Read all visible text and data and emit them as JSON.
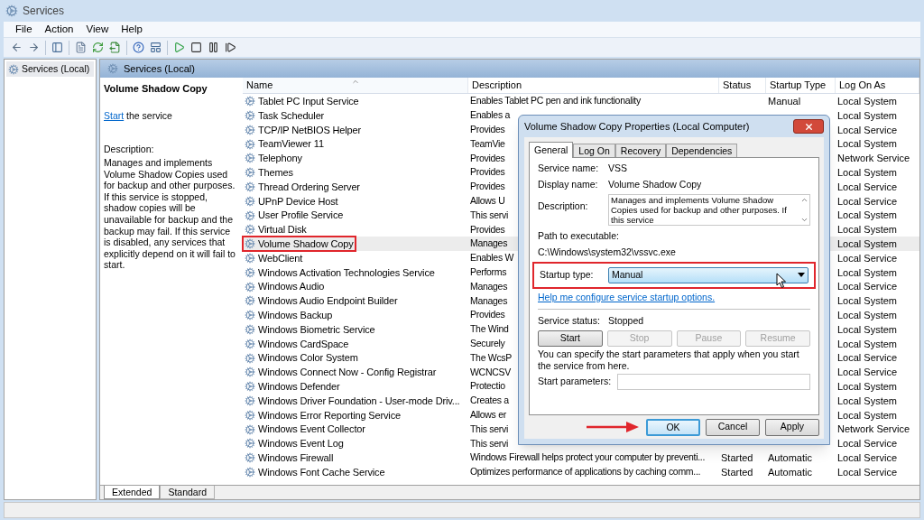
{
  "window": {
    "title": "Services"
  },
  "menu": [
    "File",
    "Action",
    "View",
    "Help"
  ],
  "tree": {
    "items": [
      {
        "label": "Services (Local)",
        "selected": true
      }
    ]
  },
  "panel": {
    "title": "Services (Local)"
  },
  "details": {
    "service_name": "Volume Shadow Copy",
    "start_link": "Start",
    "start_text": "the service",
    "description_label": "Description:",
    "description": "Manages and implements Volume Shadow Copies used for backup and other purposes. If this service is stopped, shadow copies will be unavailable for backup and the backup may fail. If this service is disabled, any services that explicitly depend on it will fail to start."
  },
  "table": {
    "columns": [
      {
        "label": "Name",
        "sorted": true
      },
      {
        "label": "Description",
        "sorted": false
      },
      {
        "label": "Status",
        "sorted": false
      },
      {
        "label": "Startup Type",
        "sorted": false
      },
      {
        "label": "Log On As",
        "sorted": false
      }
    ],
    "rows": [
      {
        "name": "Tablet PC Input Service",
        "description": "Enables Tablet PC pen and ink functionality",
        "startup_type": "Manual",
        "log_on_as": "Local System",
        "selected": false
      },
      {
        "name": "Task Scheduler",
        "description": "Enables a",
        "log_on_as": "Local System",
        "selected": false
      },
      {
        "name": "TCP/IP NetBIOS Helper",
        "description": "Provides",
        "log_on_as": "Local Service",
        "selected": false
      },
      {
        "name": "TeamViewer 11",
        "description": "TeamVie",
        "log_on_as": "Local System",
        "selected": false
      },
      {
        "name": "Telephony",
        "description": "Provides",
        "log_on_as": "Network Service",
        "selected": false
      },
      {
        "name": "Themes",
        "description": "Provides",
        "log_on_as": "Local System",
        "selected": false
      },
      {
        "name": "Thread Ordering Server",
        "description": "Provides",
        "log_on_as": "Local Service",
        "selected": false
      },
      {
        "name": "UPnP Device Host",
        "description": "Allows U",
        "log_on_as": "Local Service",
        "selected": false
      },
      {
        "name": "User Profile Service",
        "description": "This servi",
        "log_on_as": "Local System",
        "selected": false
      },
      {
        "name": "Virtual Disk",
        "description": "Provides",
        "log_on_as": "Local System",
        "selected": false
      },
      {
        "name": "Volume Shadow Copy",
        "description": "Manages",
        "log_on_as": "Local System",
        "selected": true
      },
      {
        "name": "WebClient",
        "description": "Enables W",
        "log_on_as": "Local Service",
        "selected": false
      },
      {
        "name": "Windows Activation Technologies Service",
        "description": "Performs",
        "log_on_as": "Local System",
        "selected": false
      },
      {
        "name": "Windows Audio",
        "description": "Manages",
        "log_on_as": "Local Service",
        "selected": false
      },
      {
        "name": "Windows Audio Endpoint Builder",
        "description": "Manages",
        "log_on_as": "Local System",
        "selected": false
      },
      {
        "name": "Windows Backup",
        "description": "Provides",
        "log_on_as": "Local System",
        "selected": false
      },
      {
        "name": "Windows Biometric Service",
        "description": "The Wind",
        "log_on_as": "Local System",
        "selected": false
      },
      {
        "name": "Windows CardSpace",
        "description": "Securely",
        "log_on_as": "Local System",
        "selected": false
      },
      {
        "name": "Windows Color System",
        "description": "The WcsP",
        "log_on_as": "Local Service",
        "selected": false
      },
      {
        "name": "Windows Connect Now - Config Registrar",
        "description": "WCNCSV",
        "log_on_as": "Local Service",
        "selected": false
      },
      {
        "name": "Windows Defender",
        "description": "Protectio",
        "log_on_as": "Local System",
        "selected": false
      },
      {
        "name": "Windows Driver Foundation - User-mode Driv...",
        "description": "Creates a",
        "log_on_as": "Local System",
        "selected": false
      },
      {
        "name": "Windows Error Reporting Service",
        "description": "Allows er",
        "log_on_as": "Local System",
        "selected": false
      },
      {
        "name": "Windows Event Collector",
        "description": "This servi",
        "log_on_as": "Network Service",
        "selected": false
      },
      {
        "name": "Windows Event Log",
        "description": "This servi",
        "log_on_as": "Local Service",
        "selected": false
      },
      {
        "name": "Windows Firewall",
        "description": "Windows Firewall helps protect your computer by preventi...",
        "status": "Started",
        "startup_type": "Automatic",
        "log_on_as": "Local Service",
        "selected": false
      },
      {
        "name": "Windows Font Cache Service",
        "description": "Optimizes performance of applications by caching comm...",
        "status": "Started",
        "startup_type": "Automatic",
        "log_on_as": "Local Service",
        "selected": false
      }
    ]
  },
  "view_tabs": [
    {
      "label": "Extended",
      "selected": true
    },
    {
      "label": "Standard",
      "selected": false
    }
  ],
  "dialog": {
    "title": "Volume Shadow Copy Properties (Local Computer)",
    "tabs": [
      {
        "label": "General",
        "selected": true
      },
      {
        "label": "Log On",
        "selected": false
      },
      {
        "label": "Recovery",
        "selected": false
      },
      {
        "label": "Dependencies",
        "selected": false
      }
    ],
    "fields": [
      {
        "label": "Service name:",
        "value": "VSS"
      },
      {
        "label": "Display name:",
        "value": "Volume Shadow Copy"
      }
    ],
    "description": {
      "label": "Description:",
      "value": "Manages and implements Volume Shadow Copies used for backup and other purposes. If this service"
    },
    "path": {
      "label": "Path to executable:",
      "value": "C:\\Windows\\system32\\vssvc.exe"
    },
    "startup_type": {
      "label": "Startup type:",
      "value": "Manual",
      "highlighted": true
    },
    "help_link": "Help me configure service startup options.",
    "service_status": {
      "label": "Service status:",
      "value": "Stopped"
    },
    "control_buttons": [
      {
        "label": "Start",
        "disabled": false
      },
      {
        "label": "Stop",
        "disabled": true
      },
      {
        "label": "Pause",
        "disabled": true
      },
      {
        "label": "Resume",
        "disabled": true
      }
    ],
    "hint": "You can specify the start parameters that apply when you start the service from here.",
    "start_parameters": {
      "label": "Start parameters:"
    },
    "buttons": [
      {
        "label": "OK",
        "default": true
      },
      {
        "label": "Cancel",
        "default": false
      },
      {
        "label": "Apply",
        "default": false
      }
    ]
  }
}
